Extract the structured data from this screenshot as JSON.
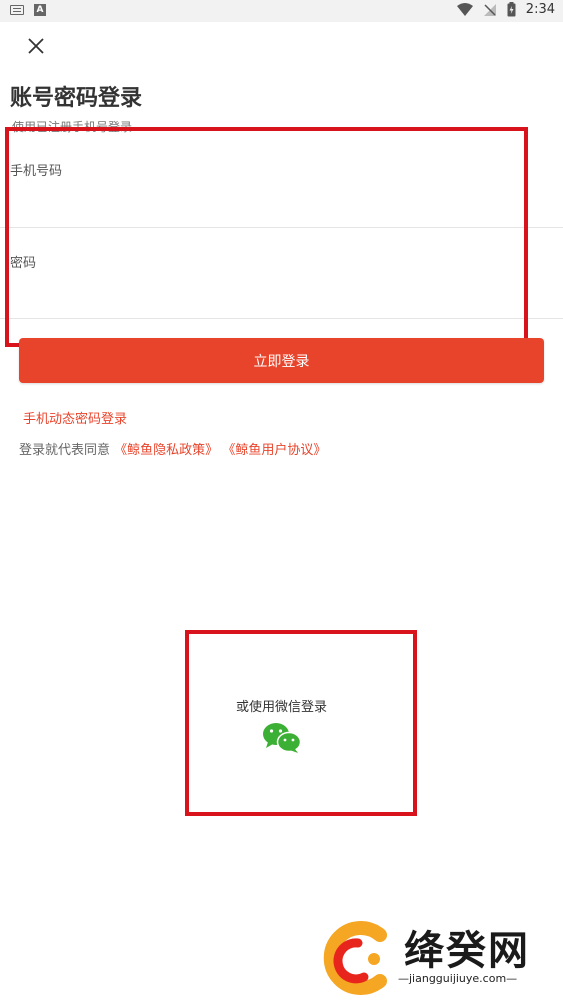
{
  "status_bar": {
    "time": "2:34",
    "left_icons": [
      "keyboard-icon",
      "a-icon"
    ],
    "right_icons": [
      "wifi-icon",
      "no-signal-icon",
      "battery-icon"
    ]
  },
  "header": {
    "close_icon": "close-icon",
    "title": "账号密码登录",
    "subtitle": "使用已注册手机号登录"
  },
  "form": {
    "phone_label": "手机号码",
    "phone_value": "",
    "password_label": "密码",
    "password_value": ""
  },
  "actions": {
    "login_label": "立即登录",
    "sms_login_link": "手机动态密码登录"
  },
  "agreement": {
    "prefix": "登录就代表同意",
    "privacy_link": "《鲸鱼隐私政策》",
    "terms_link": "《鲸鱼用户协议》"
  },
  "social": {
    "wechat_text": "或使用微信登录",
    "wechat_icon": "wechat-icon"
  },
  "watermark": {
    "text": "绛癸网",
    "url": "—jiangguijiuye.com—"
  },
  "colors": {
    "accent": "#e8442b",
    "annotation": "#d9131b",
    "wechat": "#3cb034"
  }
}
